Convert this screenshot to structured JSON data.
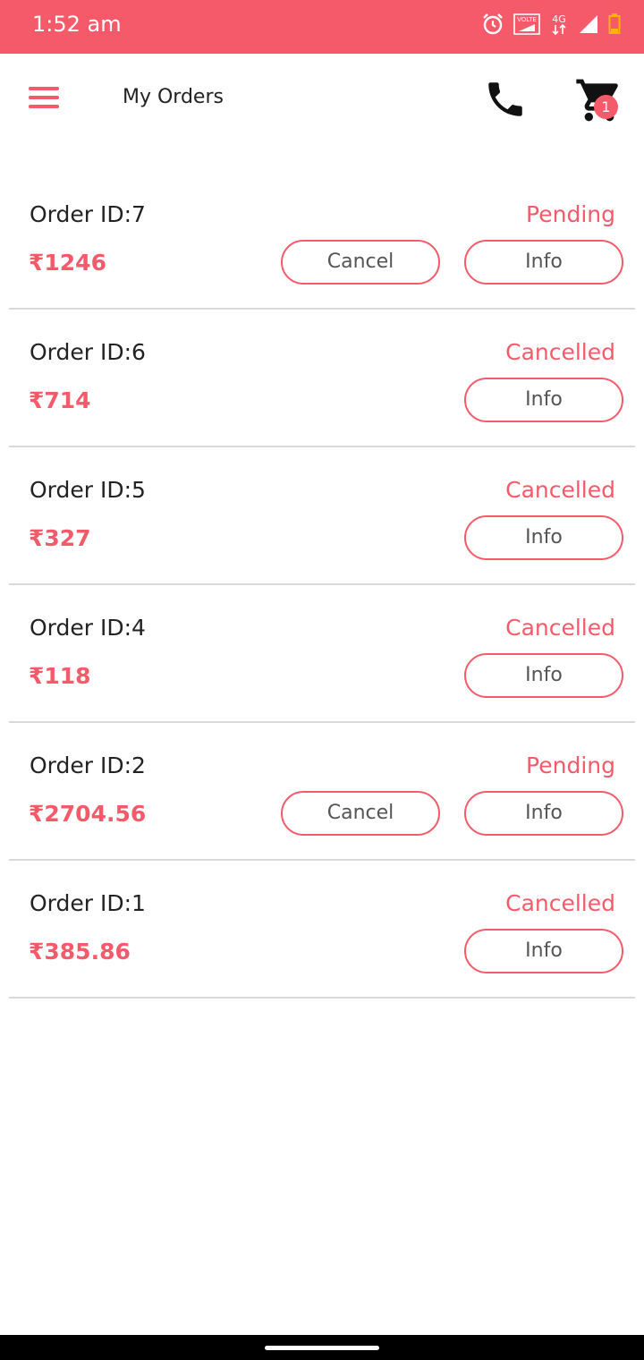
{
  "status_bar": {
    "time": "1:52 am",
    "icons": [
      "alarm-icon",
      "volte-icon",
      "4g-icon",
      "signal-icon",
      "battery-icon"
    ],
    "volte_text": "VOLTE",
    "network_text": "4G",
    "background": "#f55a6a"
  },
  "app_bar": {
    "title": "My Orders",
    "cart_count": "1"
  },
  "orders": [
    {
      "id_label": "Order ID:7",
      "price": "₹1246",
      "status": "Pending",
      "cancel_label": "Cancel",
      "info_label": "Info"
    },
    {
      "id_label": "Order ID:6",
      "price": "₹714",
      "status": "Cancelled",
      "info_label": "Info"
    },
    {
      "id_label": "Order ID:5",
      "price": "₹327",
      "status": "Cancelled",
      "info_label": "Info"
    },
    {
      "id_label": "Order ID:4",
      "price": "₹118",
      "status": "Cancelled",
      "info_label": "Info"
    },
    {
      "id_label": "Order ID:2",
      "price": "₹2704.56",
      "status": "Pending",
      "cancel_label": "Cancel",
      "info_label": "Info"
    },
    {
      "id_label": "Order ID:1",
      "price": "₹385.86",
      "status": "Cancelled",
      "info_label": "Info"
    }
  ],
  "colors": {
    "accent": "#f55a6a",
    "text": "#222222",
    "divider": "#d9d9d9"
  }
}
